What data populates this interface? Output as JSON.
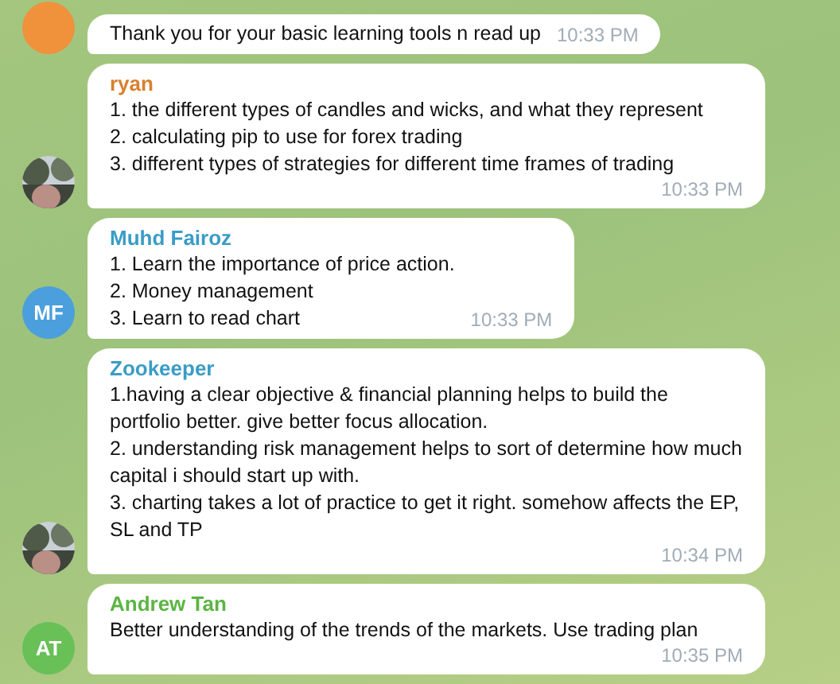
{
  "messages": [
    {
      "avatar": {
        "kind": "initials",
        "color": "#f0913c"
      },
      "text": "Thank you for your basic learning tools n read up",
      "time": "10:33 PM"
    },
    {
      "sender": "ryan",
      "color": "#d9802e",
      "text": "1. the different types of candles and wicks, and what they represent\n2. calculating pip to use for forex trading\n3. different types of strategies for different time frames of trading",
      "time": "10:33 PM"
    },
    {
      "sender": "Muhd Fairoz",
      "color": "#3a9cc6",
      "avatar": {
        "kind": "initials",
        "initials": "MF",
        "color": "#4a9fdc"
      },
      "text": "1. Learn the importance of price action.\n2. Money management\n3. Learn to read chart",
      "time": "10:33 PM"
    },
    {
      "sender": "Zookeeper",
      "color": "#3a9cc6",
      "text": "1.having a clear objective & financial planning helps to build the portfolio better. give better focus allocation.\n2. understanding risk management helps to sort of determine how much capital i should start up with.\n3. charting takes a lot of practice to get it right. somehow affects the EP, SL and TP",
      "time": "10:34 PM"
    },
    {
      "sender": "Andrew Tan",
      "color": "#5bb543",
      "avatar": {
        "kind": "initials",
        "initials": "AT",
        "color": "#68c057"
      },
      "text": "Better understanding of the trends of the markets. Use trading plan",
      "time": "10:35 PM"
    }
  ]
}
